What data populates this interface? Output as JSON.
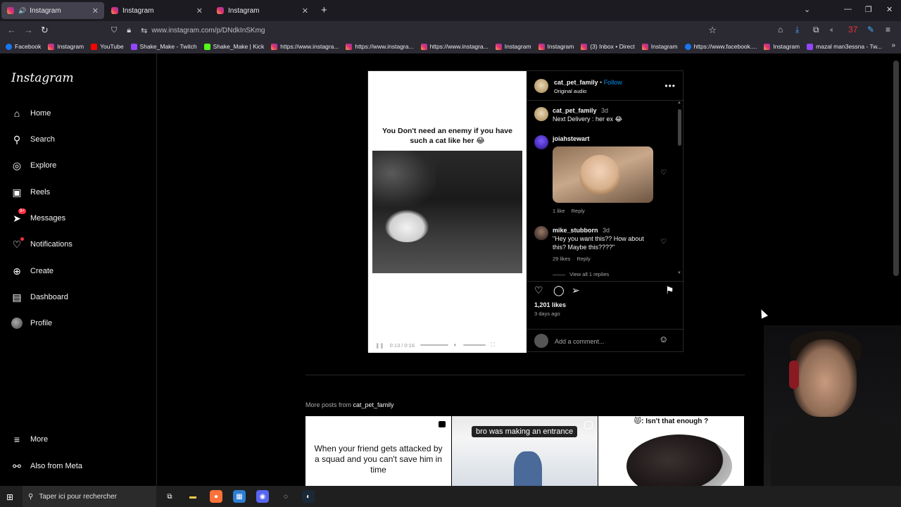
{
  "browser": {
    "tabs": [
      {
        "label": "Instagram",
        "active": true,
        "audio": true
      },
      {
        "label": "Instagram",
        "active": false,
        "audio": false
      },
      {
        "label": "Instagram",
        "active": false,
        "audio": false
      }
    ],
    "url": "www.instagram.com/p/DNdkInSKmg",
    "bookmarks": [
      {
        "label": "Facebook",
        "icon": "fb"
      },
      {
        "label": "Instagram",
        "icon": "ig"
      },
      {
        "label": "YouTube",
        "icon": "yt"
      },
      {
        "label": "Shake_Make - Twitch",
        "icon": "tw"
      },
      {
        "label": "Shake_Make | Kick",
        "icon": "kk"
      },
      {
        "label": "https://www.instagra...",
        "icon": "ig"
      },
      {
        "label": "https://www.instagra...",
        "icon": "ig"
      },
      {
        "label": "https://www.instagra...",
        "icon": "ig"
      },
      {
        "label": "Instagram",
        "icon": "ig"
      },
      {
        "label": "Instagram",
        "icon": "ig"
      },
      {
        "label": "(3) Inbox • Direct",
        "icon": "ig"
      },
      {
        "label": "Instagram",
        "icon": "ig"
      },
      {
        "label": "https://www.facebook....",
        "icon": "fb"
      },
      {
        "label": "Instagram",
        "icon": "ig"
      },
      {
        "label": "mazal man3essna - Tw...",
        "icon": "tw"
      }
    ],
    "toolbar_badge": "37"
  },
  "sidebar": {
    "logo": "Instagram",
    "items": [
      {
        "label": "Home",
        "icon": "home-icon"
      },
      {
        "label": "Search",
        "icon": "search-icon"
      },
      {
        "label": "Explore",
        "icon": "compass-icon"
      },
      {
        "label": "Reels",
        "icon": "reels-icon"
      },
      {
        "label": "Messages",
        "icon": "messenger-icon",
        "badge": "9+"
      },
      {
        "label": "Notifications",
        "icon": "heart-icon",
        "dot": true
      },
      {
        "label": "Create",
        "icon": "plus-square-icon"
      },
      {
        "label": "Dashboard",
        "icon": "chart-icon"
      },
      {
        "label": "Profile",
        "icon": "avatar"
      }
    ],
    "bottom": [
      {
        "label": "More",
        "icon": "menu-icon"
      },
      {
        "label": "Also from Meta",
        "icon": "meta-icon"
      }
    ]
  },
  "post": {
    "media_caption": "You Don't need an enemy if you have such a cat like her 😂",
    "video_time": "0:13 / 0:16",
    "author": "cat_pet_family",
    "follow_sep": " • ",
    "follow": "Follow",
    "audio": "Original audio",
    "caption": {
      "user": "cat_pet_family",
      "time": "3d",
      "text": "Next Delivery : her ex 😂"
    },
    "comments": [
      {
        "user": "joiahstewart",
        "likes": "1 like",
        "reply": "Reply"
      },
      {
        "user": "mike_stubborn",
        "time": "3d",
        "text": "\"Hey you want this?? How about this? Maybe this????\"",
        "likes": "29 likes",
        "reply": "Reply",
        "view_replies": "View all 1 replies"
      }
    ],
    "likes": "1,201 likes",
    "ago": "3 days ago",
    "add_comment_placeholder": "Add a comment..."
  },
  "more_posts": {
    "prefix": "More posts from ",
    "user": "cat_pet_family",
    "thumbs": [
      {
        "text": "When your friend gets attacked by a squad and you can't save him in time"
      },
      {
        "text": "bro was making an entrance"
      },
      {
        "text": "😾: Isn't that enough ?"
      }
    ]
  },
  "taskbar": {
    "search_placeholder": "Taper ici pour rechercher"
  }
}
